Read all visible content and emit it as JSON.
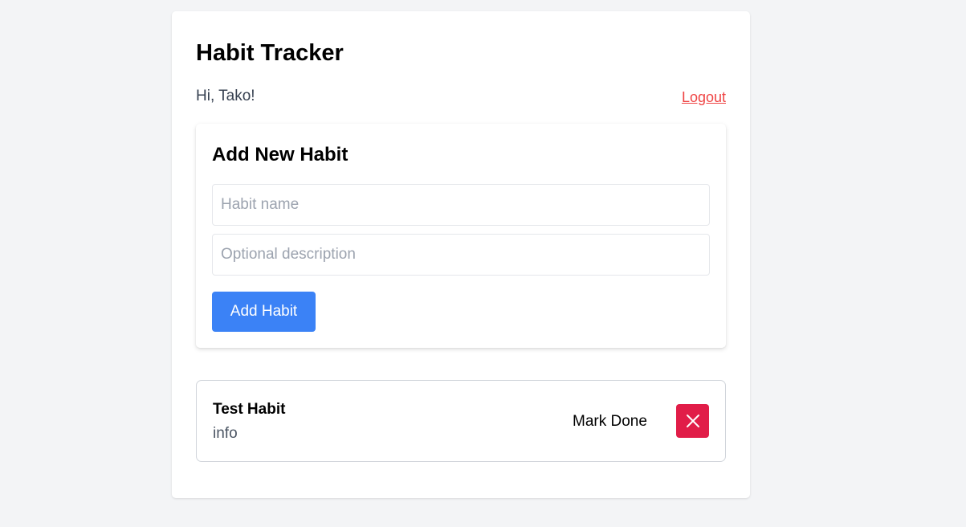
{
  "app": {
    "title": "Habit Tracker",
    "greeting": "Hi, Tako!",
    "logout_label": "Logout"
  },
  "add_form": {
    "title": "Add New Habit",
    "name_placeholder": "Habit name",
    "name_value": "",
    "description_placeholder": "Optional description",
    "description_value": "",
    "submit_label": "Add Habit"
  },
  "habits": [
    {
      "name": "Test Habit",
      "description": "info",
      "mark_done_label": "Mark Done",
      "delete_icon": "close-icon"
    }
  ],
  "colors": {
    "background": "#f3f4f6",
    "accent": "#3b82f6",
    "logout": "#ef4444",
    "delete": "#e11d48"
  }
}
